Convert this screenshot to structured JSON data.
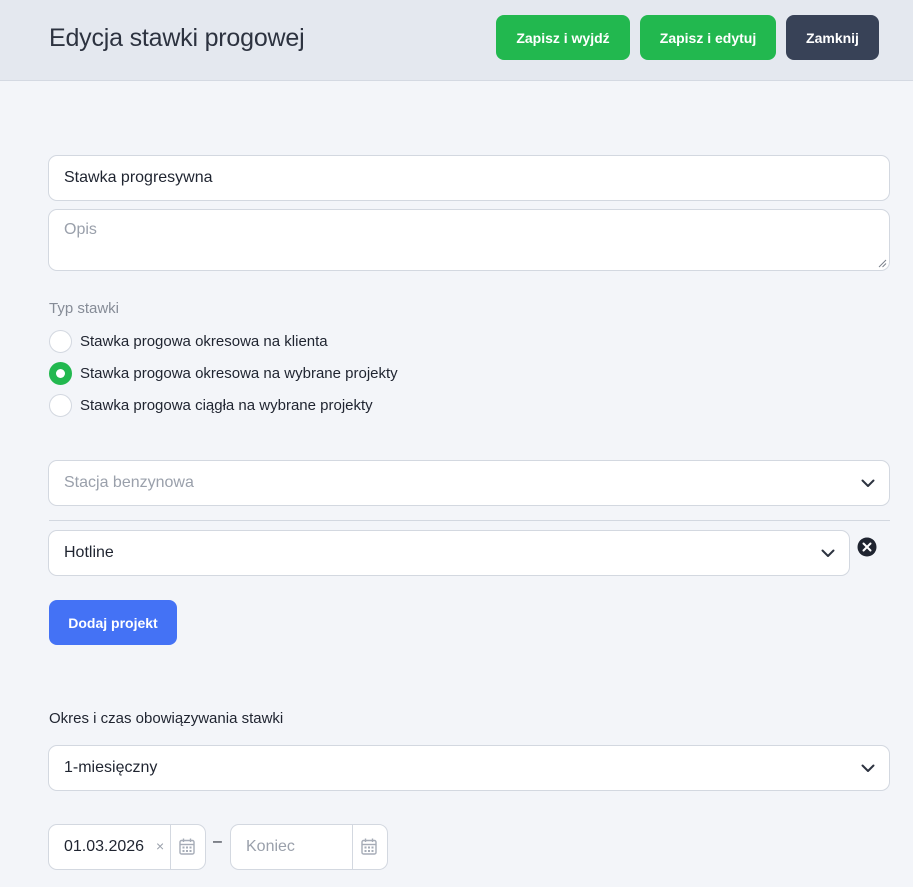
{
  "header": {
    "title": "Edycja stawki progowej",
    "buttons": {
      "save_exit": "Zapisz i wyjdź",
      "save_edit": "Zapisz i edytuj",
      "close": "Zamknij"
    }
  },
  "form": {
    "name_value": "Stawka progresywna",
    "description_placeholder": "Opis",
    "rate_type": {
      "label": "Typ stawki",
      "options": [
        {
          "label": "Stawka progowa okresowa na klienta",
          "checked": false
        },
        {
          "label": "Stawka progowa okresowa na wybrane projekty",
          "checked": true
        },
        {
          "label": "Stawka progowa ciągła na wybrane projekty",
          "checked": false
        }
      ]
    },
    "client_select_placeholder": "Stacja benzynowa",
    "project_select_value": "Hotline",
    "add_project_label": "Dodaj projekt",
    "period": {
      "label": "Okres i czas obowiązywania stawki",
      "select_value": "1-miesięczny",
      "start_date": "01.03.2026",
      "end_placeholder": "Koniec",
      "separator": "–"
    }
  },
  "colors": {
    "green": "#22b84f",
    "dark": "#384257",
    "blue": "#4472f5"
  }
}
